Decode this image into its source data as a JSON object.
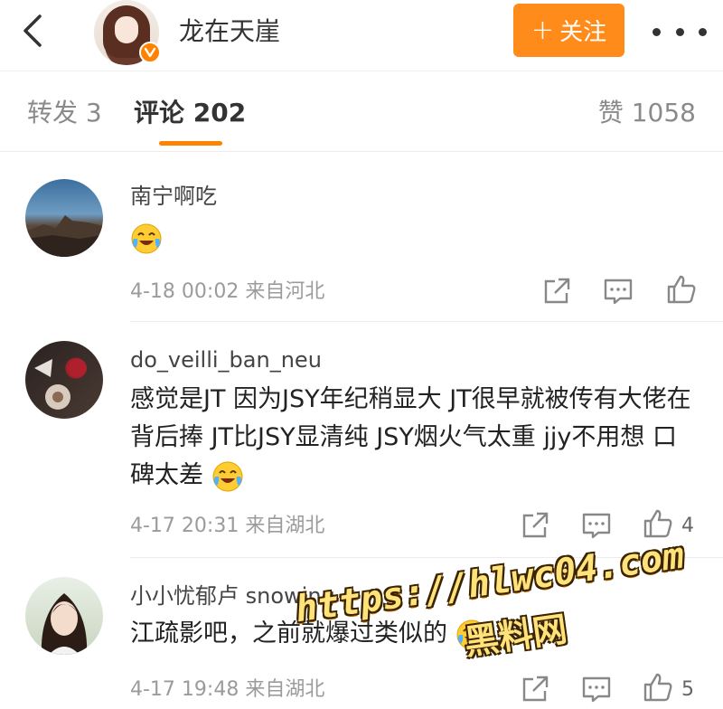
{
  "header": {
    "author_name": "龙在天崖",
    "follow_label": "关注",
    "follow_plus": "+",
    "accent_color": "#ff8c1a"
  },
  "tabs": {
    "repost": "转发 3",
    "comment": "评论 202",
    "like": "赞 1058"
  },
  "comments": [
    {
      "name": "南宁啊吃",
      "text_emoji": "laugh-cry-emoji",
      "time": "4-18 00:02",
      "location": "来自河北",
      "likes": ""
    },
    {
      "name": "do_veilli_ban_neu",
      "text": "感觉是JT  因为JSY年纪稍显大 JT很早就被传有大佬在背后捧 JT比JSY显清纯 JSY烟火气太重 jjy不用想 口碑太差",
      "text_emoji": "laugh-cry-emoji",
      "time": "4-17 20:31",
      "location": "来自湖北",
      "likes": "4"
    },
    {
      "name": "小小忧郁卢 snowing",
      "text": "江疏影吧，之前就爆过类似的",
      "text_emoji": "laugh-cry-emoji",
      "time": "4-17 19:48",
      "location": "来自湖北",
      "likes": "5"
    }
  ],
  "watermark": {
    "url": "https://hlwc04.com",
    "name": "黑料网"
  }
}
